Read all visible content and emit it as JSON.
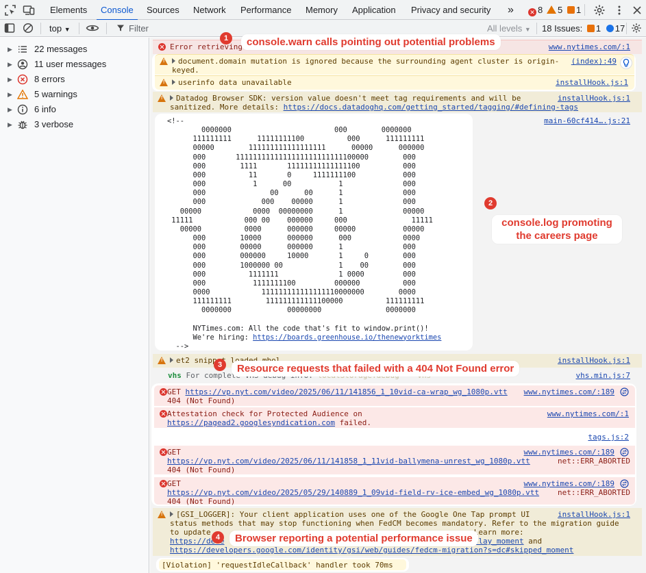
{
  "tabs": [
    "Elements",
    "Console",
    "Sources",
    "Network",
    "Performance",
    "Memory",
    "Application",
    "Privacy and security"
  ],
  "more_tabs": "»",
  "header_counts": {
    "errors": "8",
    "warnings": "5",
    "issues": "1"
  },
  "toolbar": {
    "context": "top",
    "filter_placeholder": "Filter",
    "levels": "All levels",
    "issues_label": "18 Issues:",
    "issues_a": "1",
    "issues_b": "17"
  },
  "sidebar": [
    {
      "label": "22 messages",
      "icon": "list-icon"
    },
    {
      "label": "11 user messages",
      "icon": "user-icon"
    },
    {
      "label": "8 errors",
      "icon": "error-icon"
    },
    {
      "label": "5 warnings",
      "icon": "warning-icon"
    },
    {
      "label": "6 info",
      "icon": "info-icon"
    },
    {
      "label": "3 verbose",
      "icon": "bug-icon"
    }
  ],
  "messages": {
    "m1": {
      "text": "Error retrieving",
      "src": "www.nytimes.com/:1"
    },
    "m2": {
      "line1": "document.domain mutation is ignored because the surrounding agent cluster is origin-",
      "line2": "keyed.",
      "src": "(index):49"
    },
    "m3": {
      "text": "userinfo data unavailable",
      "src": "installHook.js:1"
    },
    "m4": {
      "line1": "Datadog Browser SDK: version value doesn't meet tag requirements and will be",
      "line2": "sanitized. More details:",
      "link": "https://docs.datadoghq.com/getting_started/tagging/#defining-tags",
      "src": "installHook.js:1"
    },
    "m5": {
      "src": "main-60cf414….js:21"
    },
    "m6": {
      "text": "et2 snippet loaded mbol",
      "src": "installHook.js:1"
    },
    "m7": {
      "tag": "vhs",
      "text": "For complete VHS debug info:",
      "faded": "localStorage.debug = 'vhs'",
      "src": "vhs.min.js:7"
    },
    "e1": {
      "method": "GET",
      "url": "https://vp.nyt.com/video/2025/06/11/141856_1_10vid-ca-wrap_wg_1080p.vtt",
      "status": "404 (Not Found)",
      "src": "www.nytimes.com/:189"
    },
    "e2": {
      "line1": "Attestation check for Protected Audience on",
      "link": "https://pagead2.googlesyndication.com",
      "tail": "failed.",
      "src": "www.nytimes.com/:1"
    },
    "e2b": {
      "src": "tags.js:2"
    },
    "e3": {
      "method": "GET",
      "url": "https://vp.nyt.com/video/2025/06/11/141858_1_11vid-ballymena-unrest_wg_1080p.vtt",
      "extra": "net::ERR_ABORTED",
      "status": "404 (Not Found)",
      "src": "www.nytimes.com/:189"
    },
    "e4": {
      "method": "GET",
      "url": "https://vp.nyt.com/video/2025/05/29/140889_1_09vid-field-rv-ice-embed_wg_1080p.vtt",
      "extra": "net::ERR_ABORTED",
      "status": "404 (Not Found)",
      "src": "www.nytimes.com/:189"
    },
    "w5": {
      "line1": "[GSI_LOGGER]: Your client application uses one of the Google One Tap prompt UI",
      "line2": "status methods that may stop functioning when FedCM becomes mandatory. Refer to the migration guide",
      "line3": "to update",
      "line3b": ". Learn more:",
      "line4a": "https://deve",
      "line4b": "dc#display_moment",
      "line4c": "and",
      "link2": "https://developers.google.com/identity/gsi/web/guides/fedcm-migration?s=dc#skipped_moment",
      "src": "installHook.js:1"
    },
    "v1": {
      "text": "[Violation] 'requestIdleCallback' handler took 70ms"
    }
  },
  "ascii_art": "<!--\n        0000000                        000        0000000\n      111111111      11111111100          000      111111111\n      00000        111111111111111111      00000      000000\n      000       1111111111111111111111111100000        000\n      000        1111       11111111111111100          000\n      000          11       0     1111111100           000\n      000           1      00           1              000\n      000               00      00      1              000\n      000             000    00000      1              000\n   00000            0000  00000000      1              00000\n 11111            000 00    000000     000               11111\n   00000          0000      000000     00000           00000\n      000        10000      000000      000            0000\n      000        00000      000000      1              000\n      000        000000     10000       1     0        000\n      000        1000000 00             1    00        000\n      000          1111111              1 0000         000\n      000           1111111100         000000          000\n      0000            111111111111111110000000        0000\n      111111111        111111111111100000          111111111\n        0000000             00000000               0000000\n\n      NYTimes.com: All the code that's fit to window.print()!\n      We're hiring:",
  "ascii_link": "https://boards.greenhouse.io/thenewyorktimes",
  "ascii_end": "-->",
  "callouts": {
    "c1": {
      "num": "1",
      "text": "console.warn calls pointing out potential problems"
    },
    "c2": {
      "num": "2",
      "line1": "console.log promoting",
      "line2": "the careers page"
    },
    "c3": {
      "num": "3",
      "text": "Resource requests that failed with a 404 Not Found error"
    },
    "c4": {
      "num": "4",
      "text": "Browser reporting a potential performance issue"
    }
  },
  "colors": {
    "accent": "#0b57d0",
    "error": "#dc362e",
    "warning": "#e37400",
    "callout": "#e03b2f"
  }
}
